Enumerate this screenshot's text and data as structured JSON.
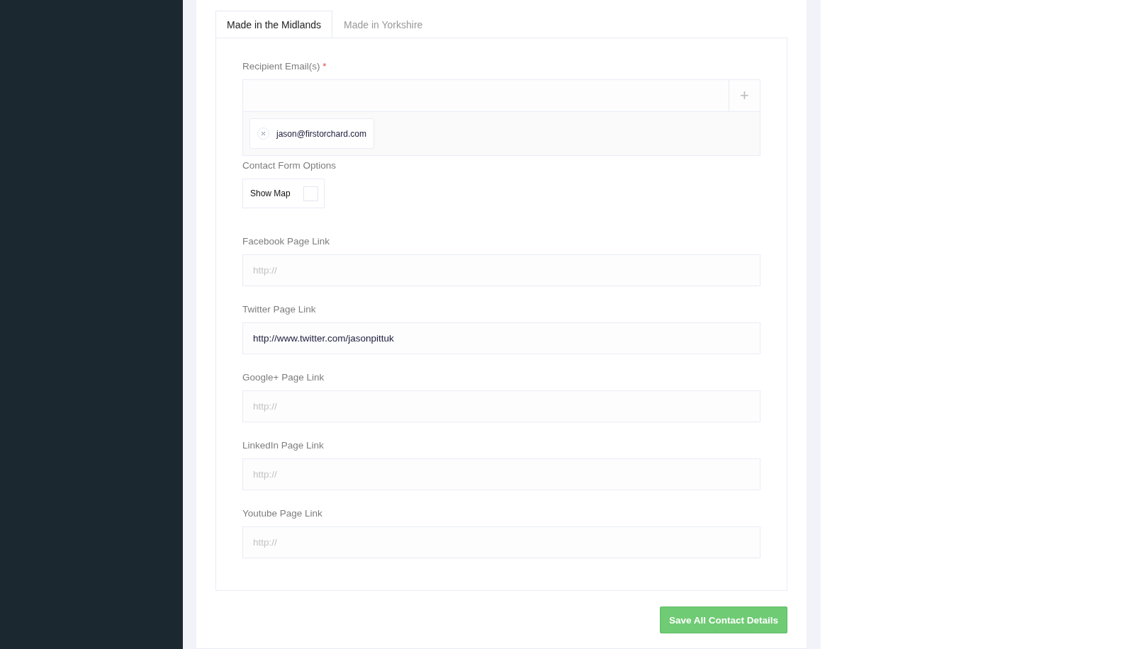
{
  "tabs": [
    {
      "label": "Made in the Midlands",
      "selected": true
    },
    {
      "label": "Made in Yorkshire",
      "selected": false
    }
  ],
  "recipients": {
    "label": "Recipient Email(s)",
    "required_mark": "*",
    "add_button": "+",
    "emails": [
      "jason@firstorchard.com"
    ]
  },
  "options": {
    "label": "Contact Form Options",
    "items": [
      {
        "label": "Show Map",
        "checked": false
      }
    ]
  },
  "links": [
    {
      "label": "Facebook Page Link",
      "placeholder": "http://"
    },
    {
      "label": "Twitter Page Link",
      "value": "http://www.twitter.com/jasonpittuk"
    },
    {
      "label": "Google+ Page Link",
      "placeholder": "http://"
    },
    {
      "label": "LinkedIn Page Link",
      "placeholder": "http://"
    },
    {
      "label": "Youtube Page Link",
      "placeholder": "http://"
    }
  ],
  "save_button": "Save All Contact Details"
}
